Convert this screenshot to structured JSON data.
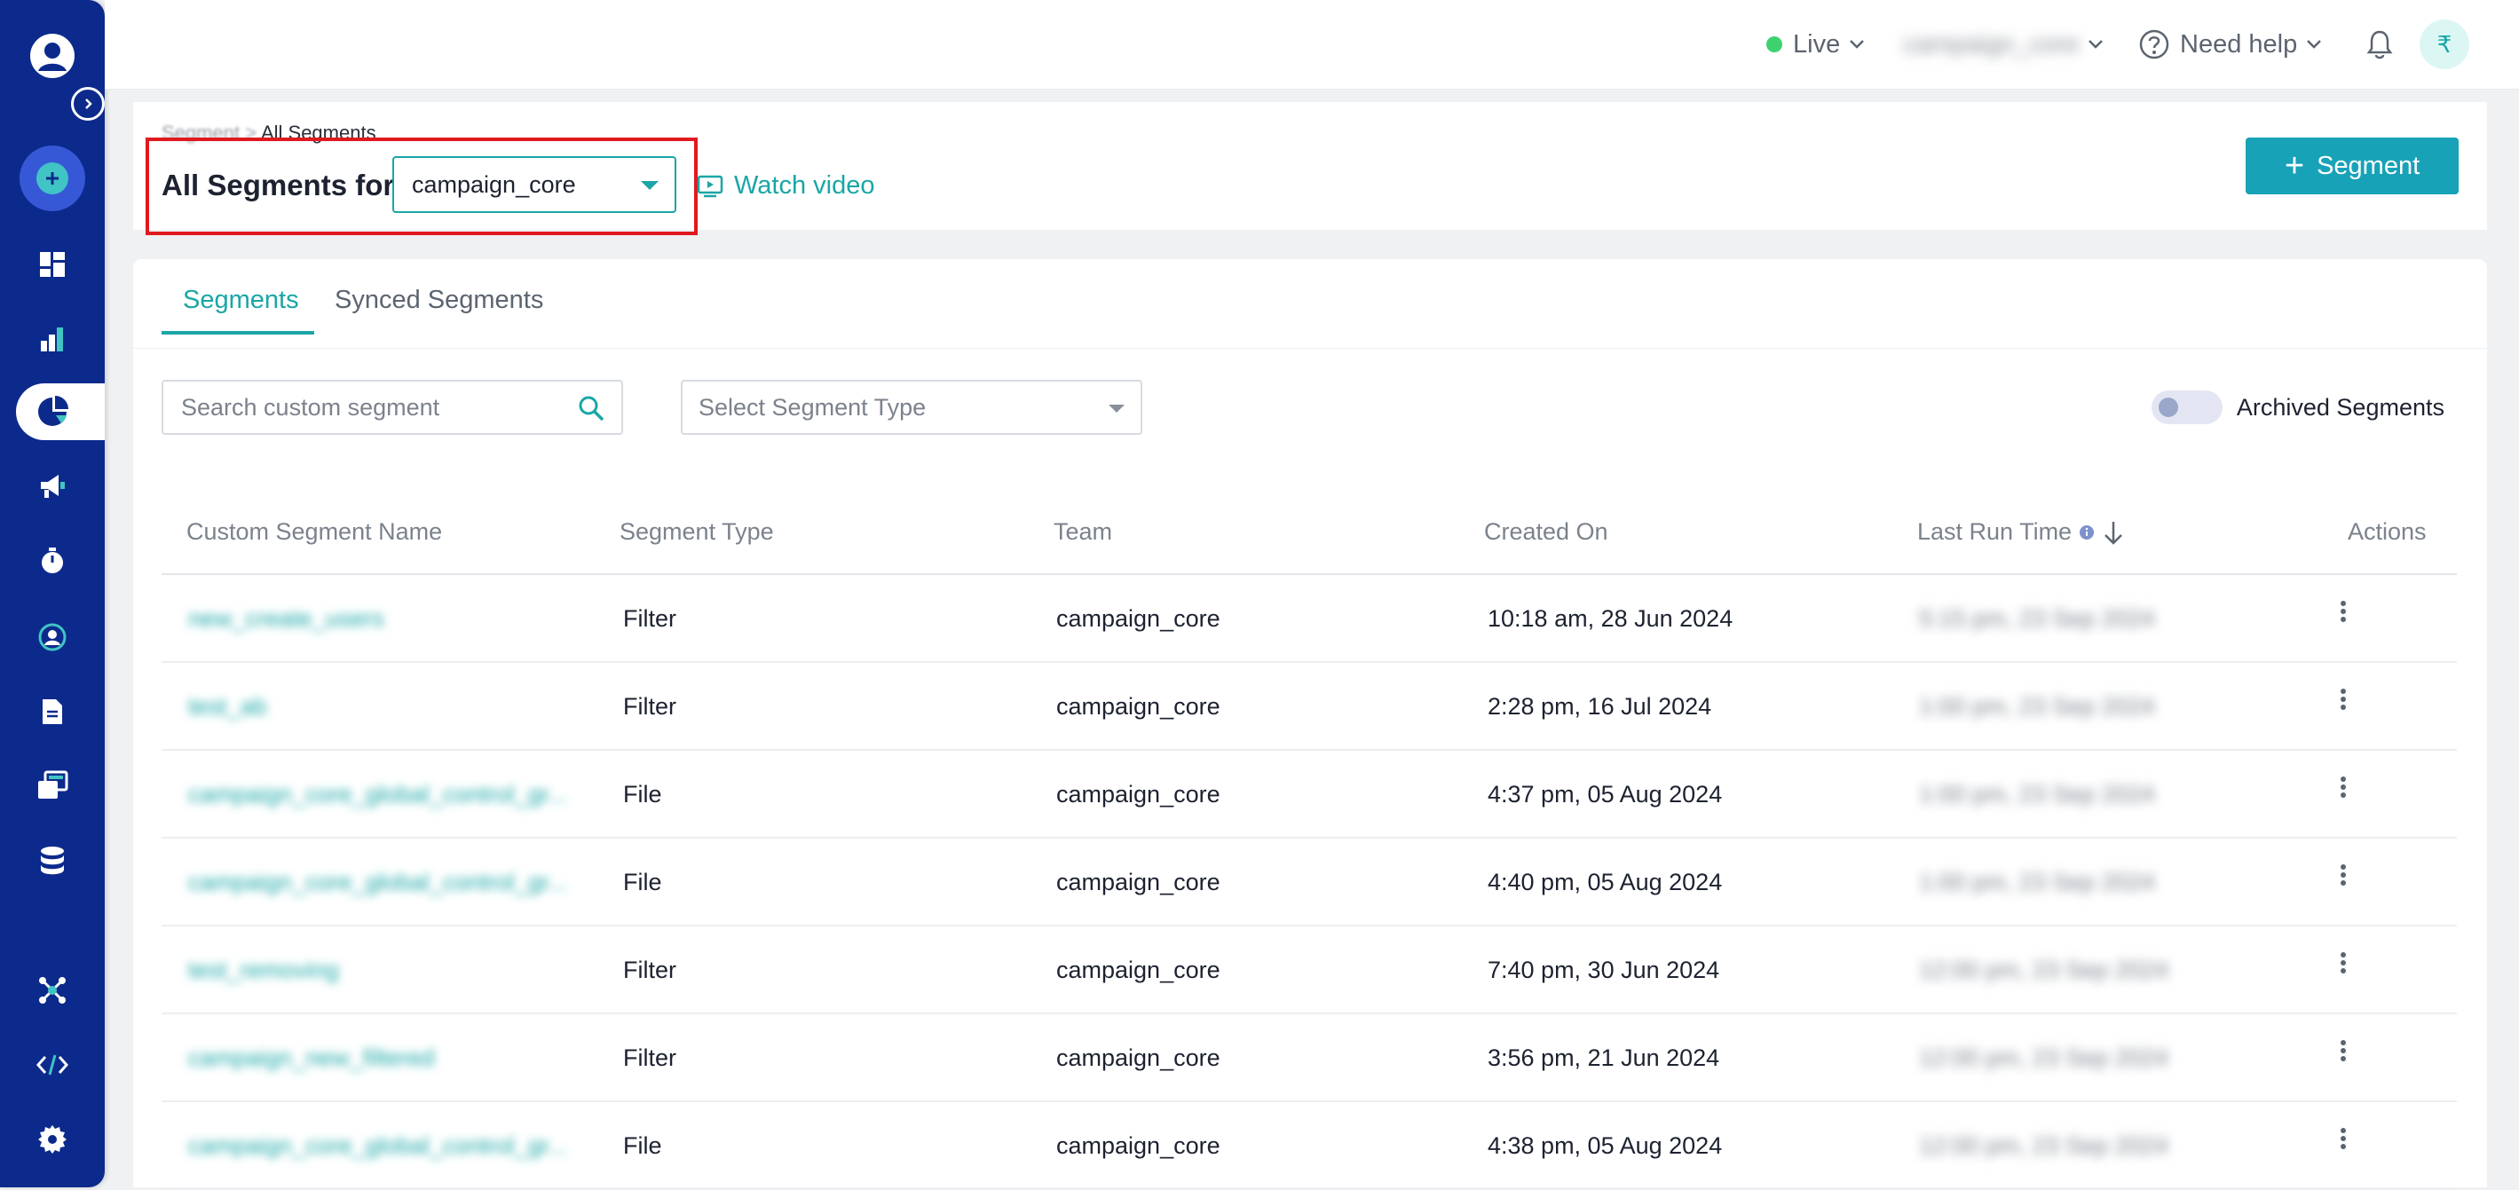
{
  "topbar": {
    "env_label": "Live",
    "account_label": "campaign_core",
    "help_label": "Need help",
    "currency_symbol": "₹"
  },
  "header": {
    "breadcrumb_root": "Segment",
    "breadcrumb_separator": ">",
    "breadcrumb_current": "All Segments",
    "title": "All Segments for",
    "team_selected": "campaign_core",
    "watch_video": "Watch video",
    "add_segment": "Segment"
  },
  "tabs": [
    {
      "label": "Segments",
      "active": true
    },
    {
      "label": "Synced Segments",
      "active": false
    }
  ],
  "filters": {
    "search_placeholder": "Search custom segment",
    "type_placeholder": "Select Segment Type",
    "archived_label": "Archived Segments",
    "archived_on": false
  },
  "table": {
    "columns": [
      "Custom Segment Name",
      "Segment Type",
      "Team",
      "Created On",
      "Last Run Time",
      "Actions"
    ],
    "rows": [
      {
        "name": "new_create_users",
        "type": "Filter",
        "team": "campaign_core",
        "created": "10:18 am, 28 Jun 2024",
        "last_run": "5:15 pm, 23 Sep 2024"
      },
      {
        "name": "test_ab",
        "type": "Filter",
        "team": "campaign_core",
        "created": "2:28 pm, 16 Jul 2024",
        "last_run": "1:00 pm, 23 Sep 2024"
      },
      {
        "name": "campaign_core_global_control_gr...",
        "type": "File",
        "team": "campaign_core",
        "created": "4:37 pm, 05 Aug 2024",
        "last_run": "1:00 pm, 23 Sep 2024"
      },
      {
        "name": "campaign_core_global_control_gr...",
        "type": "File",
        "team": "campaign_core",
        "created": "4:40 pm, 05 Aug 2024",
        "last_run": "1:00 pm, 23 Sep 2024"
      },
      {
        "name": "test_removing",
        "type": "Filter",
        "team": "campaign_core",
        "created": "7:40 pm, 30 Jun 2024",
        "last_run": "12:00 pm, 23 Sep 2024"
      },
      {
        "name": "campaign_new_filtered",
        "type": "Filter",
        "team": "campaign_core",
        "created": "3:56 pm, 21 Jun 2024",
        "last_run": "12:00 pm, 23 Sep 2024"
      },
      {
        "name": "campaign_core_global_control_gr...",
        "type": "File",
        "team": "campaign_core",
        "created": "4:38 pm, 05 Aug 2024",
        "last_run": "12:00 pm, 23 Sep 2024"
      }
    ]
  },
  "colors": {
    "sidebar": "#0c2a8c",
    "accent": "#1aa6a6",
    "button": "#17a2b8",
    "highlight": "#e0191e",
    "live": "#3dd26f"
  },
  "sidebar": {
    "items": [
      {
        "icon": "create-icon"
      },
      {
        "icon": "dashboard-icon"
      },
      {
        "icon": "analytics-icon"
      },
      {
        "icon": "segments-icon",
        "active": true
      },
      {
        "icon": "campaigns-icon"
      },
      {
        "icon": "journeys-icon"
      },
      {
        "icon": "personalize-icon"
      },
      {
        "icon": "content-icon"
      },
      {
        "icon": "templates-icon"
      },
      {
        "icon": "data-icon"
      },
      {
        "icon": "integrations-icon"
      },
      {
        "icon": "developer-icon"
      },
      {
        "icon": "settings-icon"
      }
    ]
  }
}
